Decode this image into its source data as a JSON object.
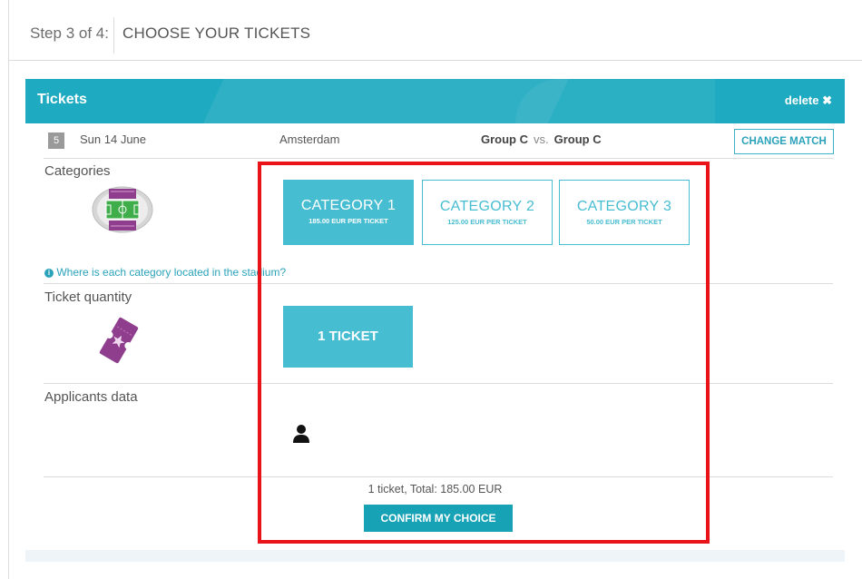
{
  "step": {
    "label": "Step 3 of 4:",
    "title": "CHOOSE YOUR TICKETS"
  },
  "panel": {
    "title": "Tickets",
    "delete_label": "delete ✖"
  },
  "match": {
    "number": "5",
    "date": "Sun 14 June",
    "city": "Amsterdam",
    "team_home": "Group C",
    "vs": "vs.",
    "team_away": "Group C",
    "change_label": "CHANGE MATCH"
  },
  "sections": {
    "categories": "Categories",
    "quantity": "Ticket quantity",
    "applicants": "Applicants data"
  },
  "categories": [
    {
      "title": "CATEGORY 1",
      "price": "185.00 EUR PER TICKET",
      "selected": true
    },
    {
      "title": "CATEGORY 2",
      "price": "125.00 EUR PER TICKET",
      "selected": false
    },
    {
      "title": "CATEGORY 3",
      "price": "50.00 EUR PER TICKET",
      "selected": false
    }
  ],
  "info_link": "Where is each category located in the stadium?",
  "quantity_button": "1 TICKET",
  "summary": "1 ticket, Total: 185.00 EUR",
  "confirm_label": "CONFIRM MY CHOICE",
  "colors": {
    "accent": "#47bdd1",
    "header": "#1eaac0",
    "confirm": "#17a2b6",
    "highlight": "#e8141a"
  }
}
